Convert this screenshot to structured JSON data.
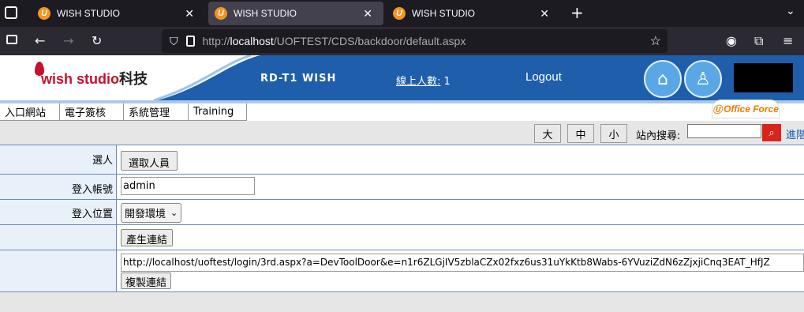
{
  "browser": {
    "tabs": [
      {
        "label": "WISH STUDIO",
        "favicon": "U"
      },
      {
        "label": "WISH STUDIO",
        "favicon": "U"
      },
      {
        "label": "WISH STUDIO",
        "favicon": "U"
      }
    ],
    "url_prefix": "http://",
    "url_host": "localhost",
    "url_path": "/UOFTEST/CDS/backdoor/default.aspx"
  },
  "header": {
    "logo_brand": "wish studio",
    "logo_cn": "科技",
    "title": "RD-T1 WISH",
    "online_label": "線上人數:",
    "online_count": "1",
    "logout": "Logout",
    "office_badge": "Office Force"
  },
  "menu": [
    "入口網站",
    "電子簽核",
    "系統管理",
    "Training"
  ],
  "toolbar": {
    "size_large": "大",
    "size_medium": "中",
    "size_small": "小",
    "search_label": "站內搜尋:",
    "advanced": "進階"
  },
  "form": {
    "select_person_label": "選人",
    "select_person_button": "選取人員",
    "account_label": "登入帳號",
    "account_value": "admin",
    "location_label": "登入位置",
    "location_value": "開發環境",
    "generate_button": "產生連結",
    "link_value": "http://localhost/uoftest/login/3rd.aspx?a=DevToolDoor&e=n1r6ZLGjIV5zblaCZx02fxz6us31uYkKtb8Wabs-6YVuziZdN6zZjxjiCnq3EAT_HfJZ",
    "copy_button": "複製連結"
  }
}
